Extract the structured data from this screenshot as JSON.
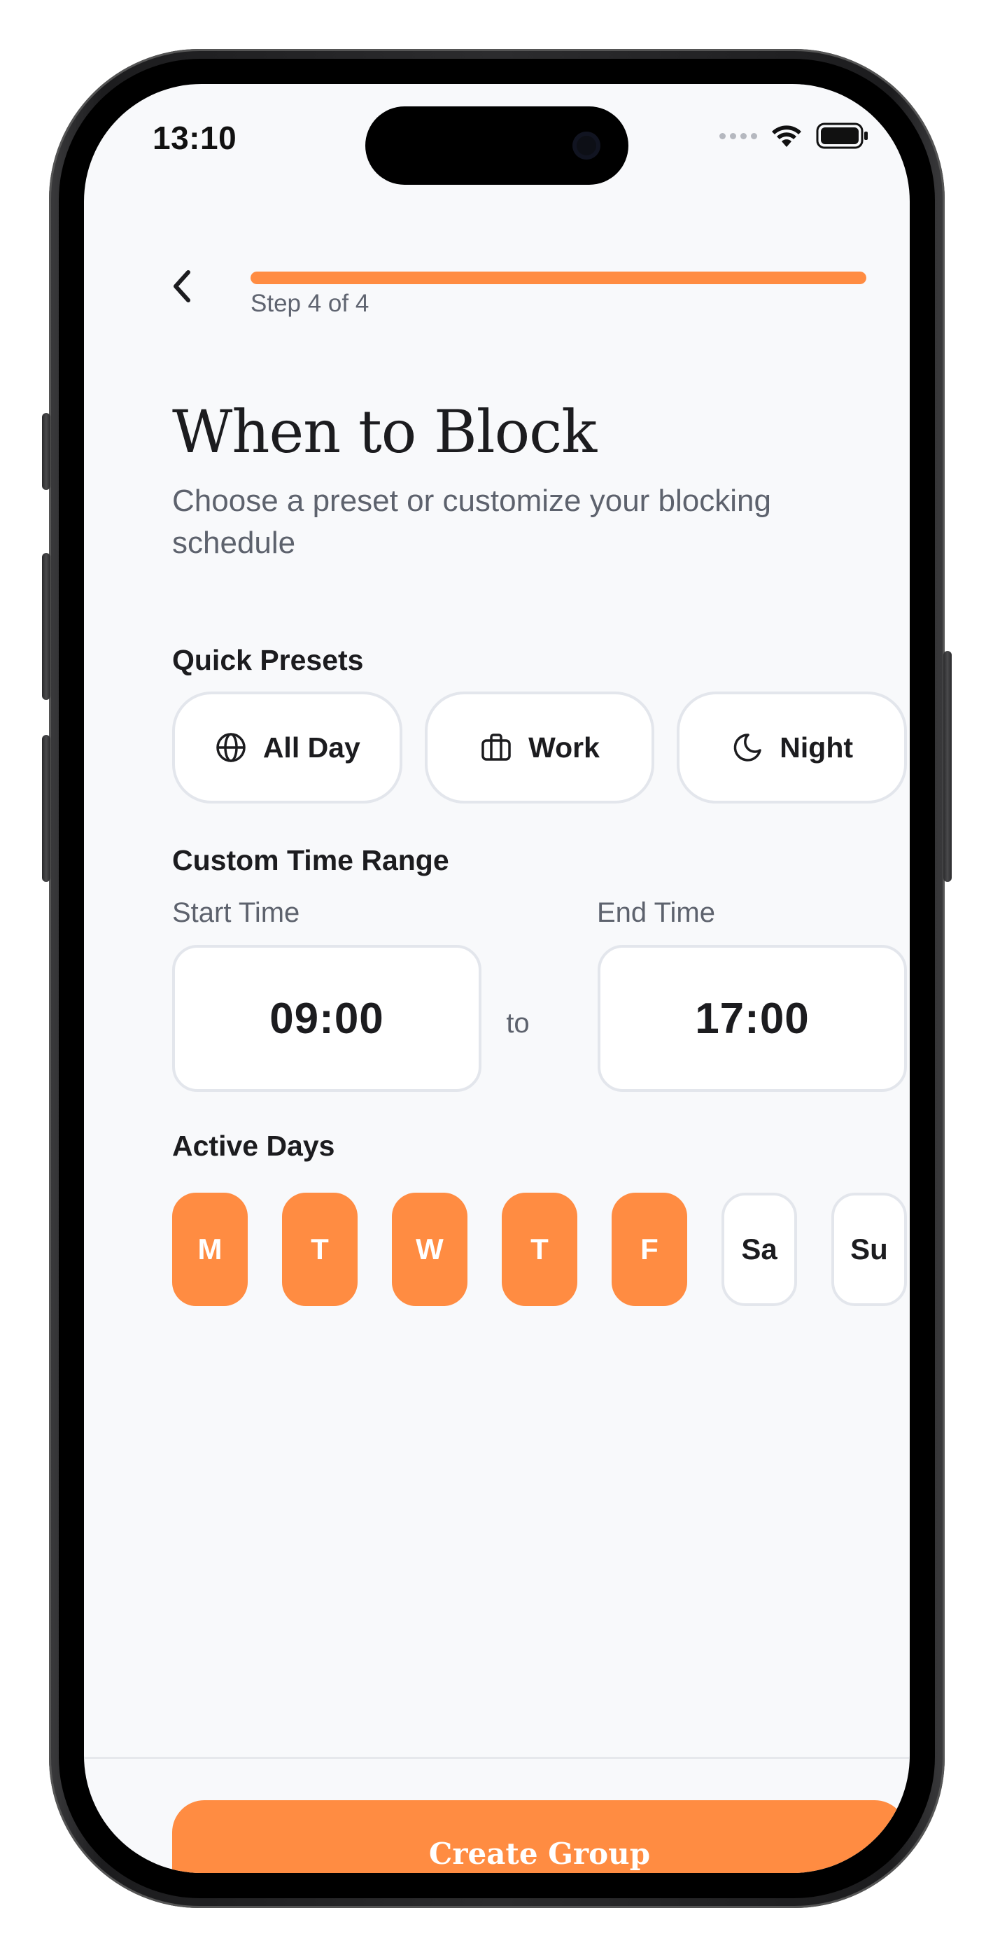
{
  "status_bar": {
    "time": "13:10"
  },
  "header": {
    "step_label": "Step 4 of 4",
    "progress": 1.0
  },
  "title": "When to Block",
  "subtitle": "Choose a preset or customize your blocking schedule",
  "quick_presets": {
    "label": "Quick Presets",
    "items": [
      {
        "label": "All Day",
        "icon": "globe-icon"
      },
      {
        "label": "Work",
        "icon": "briefcase-icon"
      },
      {
        "label": "Night",
        "icon": "moon-icon"
      }
    ]
  },
  "custom_range": {
    "label": "Custom Time Range",
    "start_label": "Start Time",
    "start_value": "09:00",
    "separator": "to",
    "end_label": "End Time",
    "end_value": "17:00"
  },
  "active_days": {
    "label": "Active Days",
    "days": [
      {
        "label": "M",
        "active": true
      },
      {
        "label": "T",
        "active": true
      },
      {
        "label": "W",
        "active": true
      },
      {
        "label": "T",
        "active": true
      },
      {
        "label": "F",
        "active": true
      },
      {
        "label": "Sa",
        "active": false
      },
      {
        "label": "Su",
        "active": false
      }
    ]
  },
  "footer": {
    "cta_label": "Create Group"
  },
  "colors": {
    "accent": "#ff8c42",
    "background": "#f8f9fb",
    "border": "#e3e6ec",
    "text_primary": "#1c1c1f",
    "text_secondary": "#5d626d"
  }
}
